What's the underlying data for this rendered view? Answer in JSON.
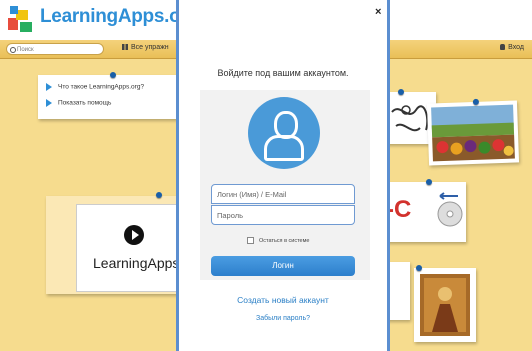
{
  "header": {
    "logo_text": "LearningApps.org",
    "search_placeholder": "Поиск",
    "all_apps_label": "Все упражн",
    "login_label": "Вход"
  },
  "board": {
    "menu_items": [
      {
        "label": "Что такое LearningApps.org?"
      },
      {
        "label": "Показать помощь"
      }
    ],
    "video_caption": "LearningApps",
    "sticker_text": "-C"
  },
  "modal": {
    "title": "Войдите под вашим аккаунтом.",
    "close_label": "×",
    "username_placeholder": "Логин (Имя) / E-Mail",
    "password_placeholder": "Пароль",
    "remember_label": "Остаться в системе",
    "login_button": "Логин",
    "create_account": "Создать новый аккаунт",
    "forgot_password": "Забыли пароль?"
  },
  "colors": {
    "accent": "#2e8fd6",
    "modal_border": "#5b8ed0",
    "board": "#f6dc8e"
  }
}
